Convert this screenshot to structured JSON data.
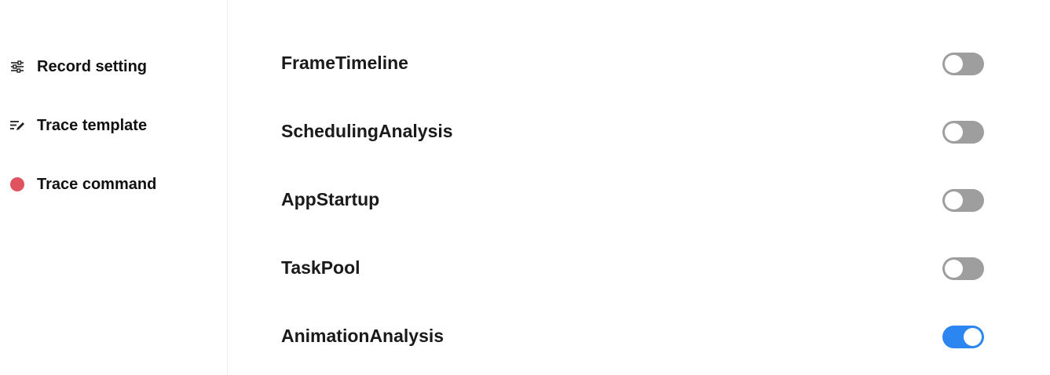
{
  "sidebar": {
    "items": [
      {
        "label": "Record setting",
        "icon": "sliders-icon"
      },
      {
        "label": "Trace template",
        "icon": "edit-list-icon"
      },
      {
        "label": "Trace command",
        "icon": "record-dot-icon",
        "color": "#e0525e"
      }
    ]
  },
  "settings": {
    "items": [
      {
        "label": "FrameTimeline",
        "enabled": false
      },
      {
        "label": "SchedulingAnalysis",
        "enabled": false
      },
      {
        "label": "AppStartup",
        "enabled": false
      },
      {
        "label": "TaskPool",
        "enabled": false
      },
      {
        "label": "AnimationAnalysis",
        "enabled": true
      }
    ]
  },
  "colors": {
    "toggle_on": "#2b86f1",
    "toggle_off": "#9e9e9e",
    "record_dot": "#e0525e"
  }
}
